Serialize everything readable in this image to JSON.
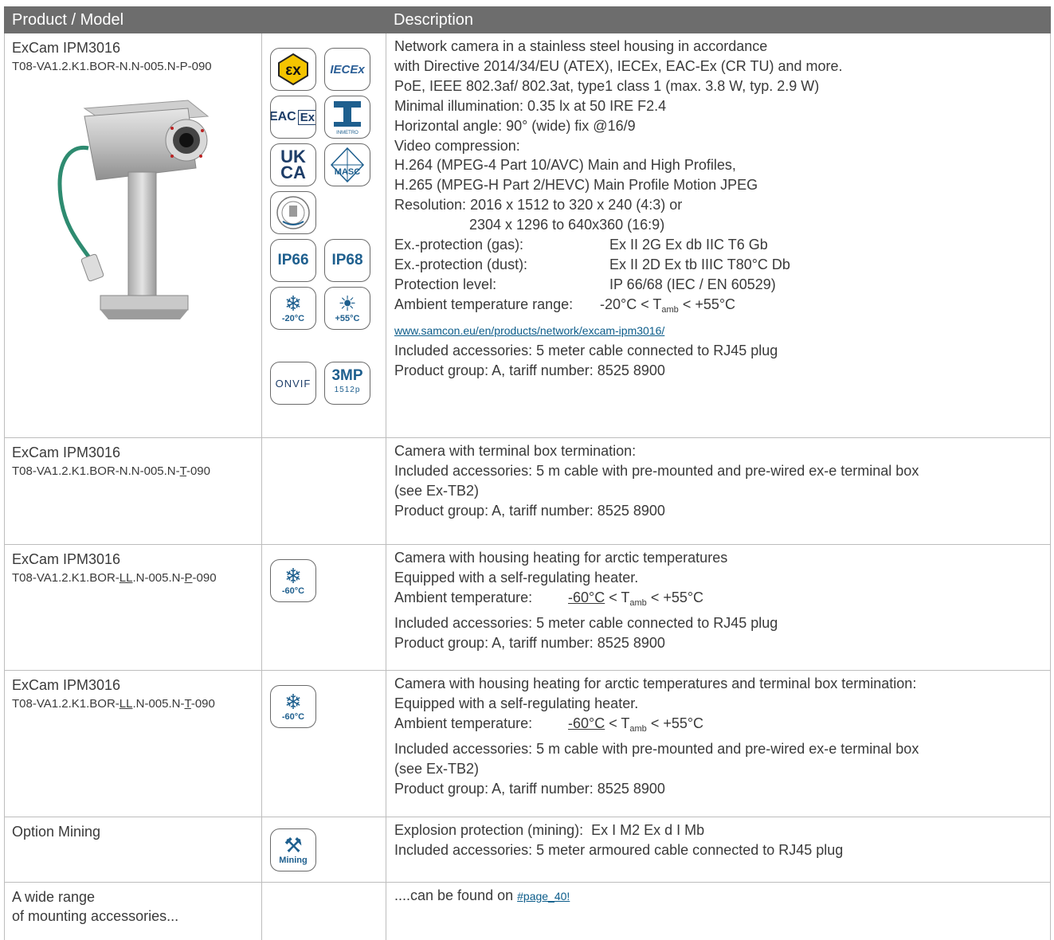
{
  "header": {
    "col1": "Product / Model",
    "col2": "Description"
  },
  "rows": [
    {
      "model": "ExCam IPM3016",
      "code": "T08-VA1.2.K1.BOR-N.N-005.N-P-090",
      "desc": {
        "l1": "Network camera in a stainless steel housing in accordance",
        "l2": "with Directive 2014/34/EU (ATEX), IECEx, EAC-Ex (CR TU) and more.",
        "l3": "PoE, IEEE 802.3af/ 802.3at, type1 class 1 (max. 3.8 W, typ. 2.9 W)",
        "l4": "Minimal illumination: 0.35 lx at 50 IRE F2.4",
        "l5": "Horizontal angle: 90° (wide) fix @16/9",
        "l6": "Video compression:",
        "l7": "H.264 (MPEG-4 Part 10/AVC) Main and High Profiles,",
        "l8": "H.265 (MPEG-H Part 2/HEVC) Main Profile Motion JPEG",
        "res_label": "Resolution:",
        "res1": "2016 x 1512 to 320 x 240 (4:3) or",
        "res2": "2304 x 1296 to 640x360 (16:9)",
        "gas_label": "Ex.-protection (gas):",
        "gas_val": "Ex II 2G Ex db IIC T6 Gb",
        "dust_label": "Ex.-protection (dust):",
        "dust_val": "Ex II 2D Ex tb IIIC T80°C Db",
        "prot_label": "Protection level:",
        "prot_val": "IP 66/68 (IEC / EN 60529)",
        "amb_label": "Ambient temperature range:",
        "amb_pre": "-20°C < T",
        "amb_sub": "amb",
        "amb_post": " < +55°C",
        "link": "www.samcon.eu/en/products/network/excam-ipm3016/",
        "acc": "Included accessories: 5 meter cable connected to RJ45 plug",
        "group": "Product group: A, tariff number: 8525 8900"
      },
      "badges": {
        "iecex": "IECEx",
        "eac": "EAC",
        "ex": "Ex",
        "inmetro": "INMETRO",
        "uk": "UK",
        "ca": "CA",
        "masc": "MASC",
        "ip66": "IP66",
        "ip68": "IP68",
        "cold": "-20°C",
        "hot": "+55°C",
        "onvif": "ONVIF",
        "mp": "3MP",
        "mp_sub": "1512p"
      }
    },
    {
      "model": "ExCam IPM3016",
      "code_a": "T08-VA1.2.K1.BOR-N.N-005.N-",
      "code_u": "T",
      "code_b": "-090",
      "l1": "Camera with terminal box termination:",
      "l2": "Included accessories: 5 m cable with pre-mounted and pre-wired ex-e terminal box",
      "l3": "(see Ex-TB2)",
      "l4": "Product group: A, tariff number: 8525 8900"
    },
    {
      "model": "ExCam IPM3016",
      "code_a": "T08-VA1.2.K1.BOR-",
      "code_u1": "LL",
      "code_m": ".N-005.N-",
      "code_u2": "P",
      "code_b": "-090",
      "badge": "-60°C",
      "l1": "Camera with housing heating for arctic temperatures",
      "l2": "Equipped with a self-regulating heater.",
      "amb_label": "Ambient temperature:",
      "amb_u": "-60°C",
      "amb_mid": " < T",
      "amb_sub": "amb",
      "amb_post": " < +55°C",
      "l4": "Included accessories: 5 meter cable connected to RJ45 plug",
      "l5": "Product group: A, tariff number: 8525 8900"
    },
    {
      "model": "ExCam IPM3016",
      "code_a": "T08-VA1.2.K1.BOR-",
      "code_u1": "LL",
      "code_m": ".N-005.N-",
      "code_u2": "T",
      "code_b": "-090",
      "badge": "-60°C",
      "l1": "Camera with housing heating for arctic temperatures and terminal box termination:",
      "l2": "Equipped with a self-regulating heater.",
      "amb_label": "Ambient temperature:",
      "amb_u": "-60°C",
      "amb_mid": " < T",
      "amb_sub": "amb",
      "amb_post": " < +55°C",
      "l4": "Included accessories: 5 m cable with pre-mounted and pre-wired ex-e terminal box",
      "l5": "(see Ex-TB2)",
      "l6": "Product group: A, tariff number: 8525 8900"
    },
    {
      "model": "Option Mining",
      "badge": "Mining",
      "l1_label": "Explosion protection (mining):",
      "l1_val": "Ex I M2 Ex d I Mb",
      "l2": "Included accessories: 5 meter armoured cable connected to RJ45 plug"
    },
    {
      "model_l1": "A wide range",
      "model_l2": "of mounting accessories...",
      "pre": "....can be found on ",
      "link": "#page_40!"
    }
  ]
}
